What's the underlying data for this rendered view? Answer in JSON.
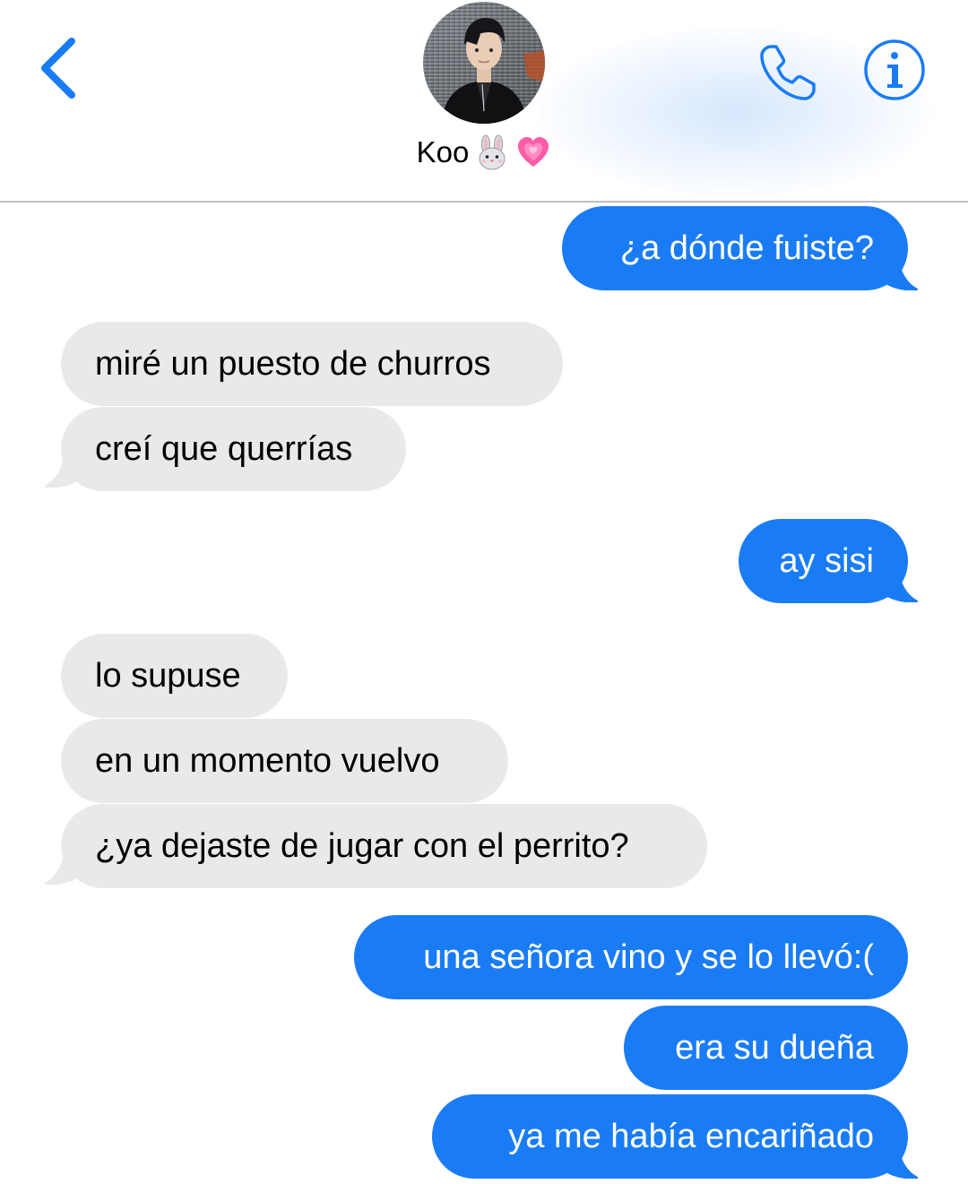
{
  "header": {
    "back_icon": "chevron-left-icon",
    "contact_name": "Koo",
    "name_emojis": [
      "bunny-face-emoji",
      "growing-heart-emoji"
    ],
    "phone_icon": "phone-icon",
    "info_icon": "info-icon",
    "accent_color": "#1a7cf5"
  },
  "messages": [
    {
      "side": "sent",
      "text": "¿a dónde fuiste?"
    },
    {
      "side": "received",
      "text": "miré un puesto de churros"
    },
    {
      "side": "received",
      "text": "creí que querrías"
    },
    {
      "side": "sent",
      "text": "ay sisi"
    },
    {
      "side": "received",
      "text": "lo supuse"
    },
    {
      "side": "received",
      "text": "en un momento vuelvo"
    },
    {
      "side": "received",
      "text": "¿ya dejaste de jugar con el perrito?"
    },
    {
      "side": "sent",
      "text": "una señora vino y se lo llevó:("
    },
    {
      "side": "sent",
      "text": "era su dueña"
    },
    {
      "side": "sent",
      "text": "ya me había encariñado"
    }
  ],
  "colors": {
    "sent_bubble": "#1a7cf5",
    "received_bubble": "#e9e9eb"
  }
}
